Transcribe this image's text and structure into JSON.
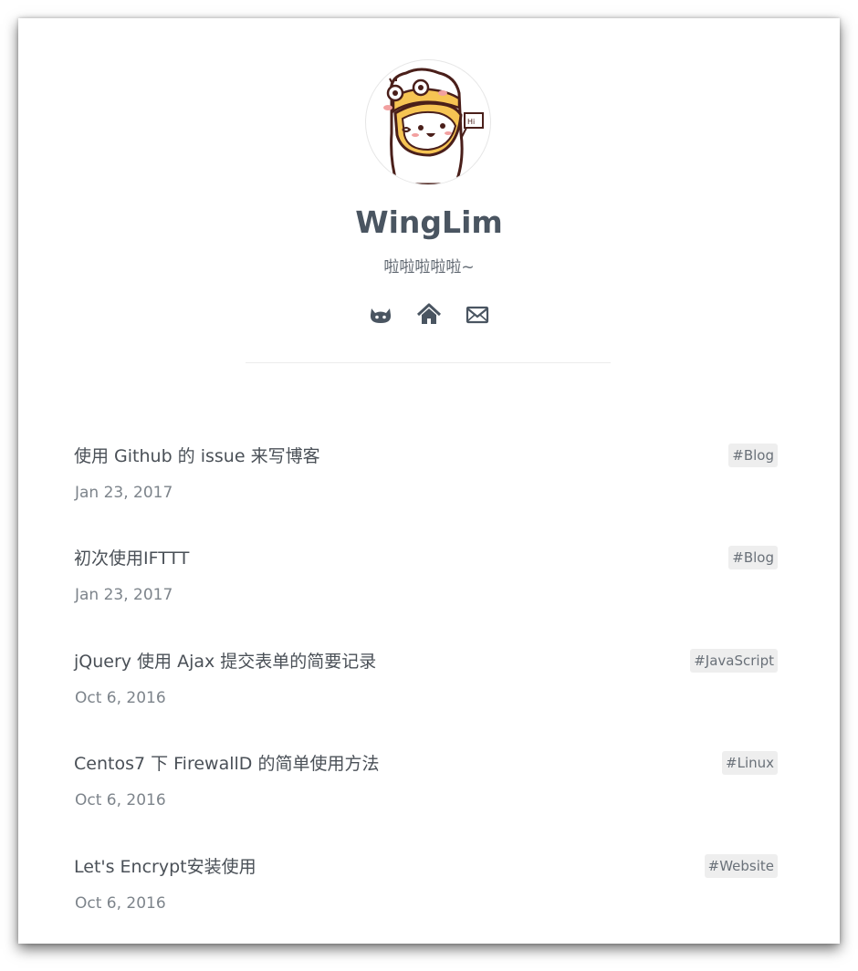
{
  "profile": {
    "name": "WingLim",
    "tagline": "啦啦啦啦啦~",
    "avatar_icon": "cartoon-avatar-icon",
    "social": [
      {
        "icon": "github-icon",
        "label": "GitHub"
      },
      {
        "icon": "home-icon",
        "label": "Home"
      },
      {
        "icon": "mail-icon",
        "label": "Email"
      }
    ]
  },
  "posts": [
    {
      "title": "使用 Github 的 issue 来写博客",
      "date": "Jan 23, 2017",
      "tag": "#Blog"
    },
    {
      "title": "初次使用IFTTT",
      "date": "Jan 23, 2017",
      "tag": "#Blog"
    },
    {
      "title": "jQuery 使用 Ajax 提交表单的简要记录",
      "date": "Oct 6, 2016",
      "tag": "#JavaScript"
    },
    {
      "title": "Centos7 下 FirewallD 的简单使用方法",
      "date": "Oct 6, 2016",
      "tag": "#Linux"
    },
    {
      "title": "Let's Encrypt安装使用",
      "date": "Oct 6, 2016",
      "tag": "#Website"
    }
  ],
  "colors": {
    "text": "#4a5561",
    "muted": "#7d848b",
    "tag_bg": "#eeeeee",
    "avatar_yellow": "#f6c453",
    "avatar_outline": "#4a1f1a"
  }
}
